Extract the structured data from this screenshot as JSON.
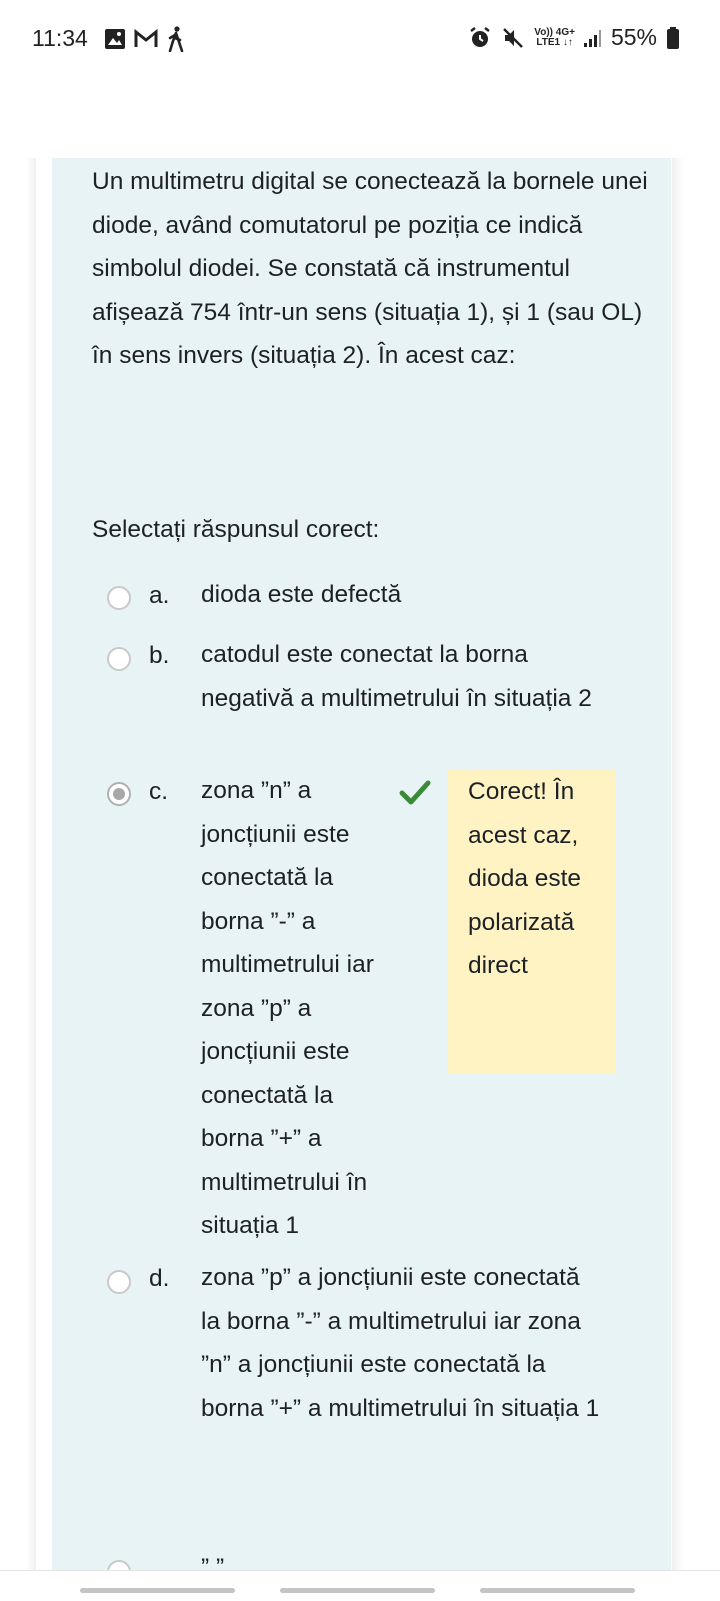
{
  "status_bar": {
    "time": "11:34",
    "battery": "55%",
    "network_top": "Vo)) 4G+",
    "network_bottom": "LTE1 ↓↑",
    "left_icons": [
      "gallery-icon",
      "gmail-icon",
      "walking-icon"
    ],
    "right_icons": [
      "alarm-icon",
      "mute-icon",
      "signal-icon",
      "battery-icon"
    ]
  },
  "question": {
    "text": "Un multimetru digital se conectează la bornele unei diode, având comutatorul pe poziția ce indică simbolul diodei. Se constată că instrumentul afișează 754 într-un sens (situația 1), și 1 (sau OL) în sens invers (situația 2). În acest caz:",
    "prompt": "Selectați răspunsul corect:"
  },
  "options": [
    {
      "letter": "a.",
      "text": "dioda este defectă",
      "selected": false
    },
    {
      "letter": "b.",
      "text": "catodul este conectat la borna negativă a multimetrului în situația 2",
      "selected": false
    },
    {
      "letter": "c.",
      "text": "zona ”n” a joncțiunii este conectată la borna ”-” a multimetrului iar zona ”p” a joncțiunii este conectată la borna ”+” a multimetrului în situația 1",
      "selected": true
    },
    {
      "letter": "d.",
      "text": "zona ”p” a joncțiunii este conectată la borna ”-” a multimetrului iar zona ”n” a joncțiunii este conectată la borna ”+” a multimetrului în situația 1",
      "selected": false
    }
  ],
  "feedback": {
    "text": "Corect! În acest caz, dioda este polarizată direct",
    "icon": "check-icon",
    "color": "#3a8a3a",
    "background": "#fff3c4"
  },
  "cut_off_text": "”  ”",
  "colors": {
    "card_background": "#e7f3f5",
    "text": "#1d2125"
  }
}
